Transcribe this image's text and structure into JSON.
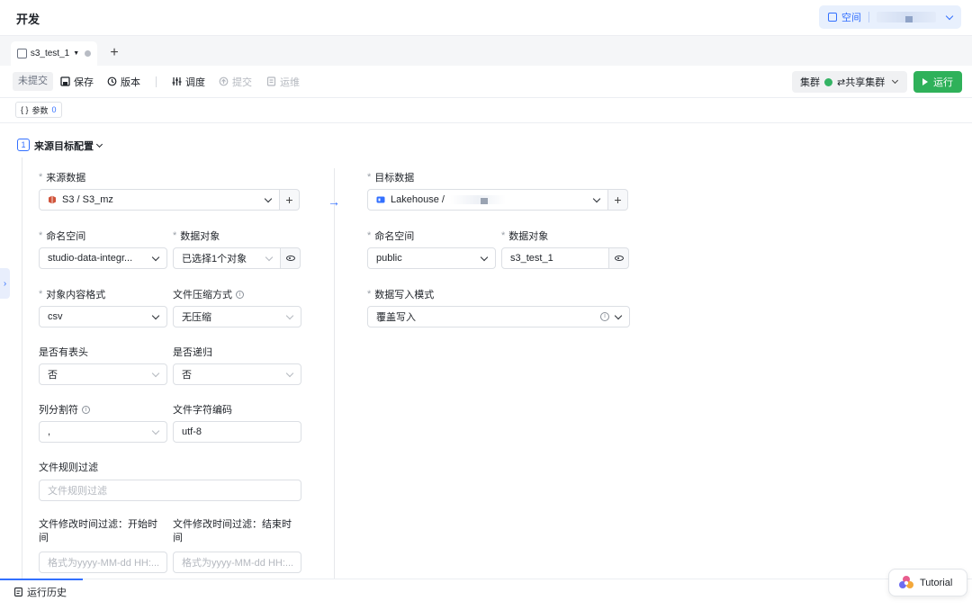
{
  "header": {
    "title": "开发",
    "space_label": "空间"
  },
  "tabs": [
    {
      "label": "s3_test_1"
    }
  ],
  "toolbar": {
    "status": "未提交",
    "save": "保存",
    "version": "版本",
    "schedule": "调度",
    "submit": "提交",
    "ops": "运维",
    "cluster_label": "集群",
    "cluster_value": "⇄共享集群",
    "run": "运行"
  },
  "params": {
    "label": "参数",
    "count": "0"
  },
  "section": {
    "number": "1",
    "title": "来源目标配置"
  },
  "source": {
    "data_label": "来源数据",
    "data_value": "S3 / S3_mz",
    "namespace_label": "命名空间",
    "namespace_value": "studio-data-integr...",
    "object_label": "数据对象",
    "object_value": "已选择1个对象",
    "format_label": "对象内容格式",
    "format_value": "csv",
    "compress_label": "文件压缩方式",
    "compress_value": "无压缩",
    "header_label": "是否有表头",
    "header_value": "否",
    "recursive_label": "是否递归",
    "recursive_value": "否",
    "delimiter_label": "列分割符",
    "delimiter_value": ",",
    "encoding_label": "文件字符编码",
    "encoding_value": "utf-8",
    "filter_label": "文件规则过滤",
    "filter_placeholder": "文件规则过滤",
    "mtime_start_label_1": "文件修改时间过滤：开始时",
    "mtime_start_label_2": "间",
    "mtime_start_placeholder": "格式为yyyy-MM-dd HH:...",
    "mtime_end_label_1": "文件修改时间过滤：结束时",
    "mtime_end_label_2": "间",
    "mtime_end_placeholder": "格式为yyyy-MM-dd HH:..."
  },
  "target": {
    "data_label": "目标数据",
    "data_value": "Lakehouse /",
    "namespace_label": "命名空间",
    "namespace_value": "public",
    "object_label": "数据对象",
    "object_value": "s3_test_1",
    "write_mode_label": "数据写入模式",
    "write_mode_value": "覆盖写入"
  },
  "bottom": {
    "history": "运行历史",
    "tutorial": "Tutorial"
  },
  "colors": {
    "accent": "#3370ff",
    "run": "#2fb15a"
  }
}
